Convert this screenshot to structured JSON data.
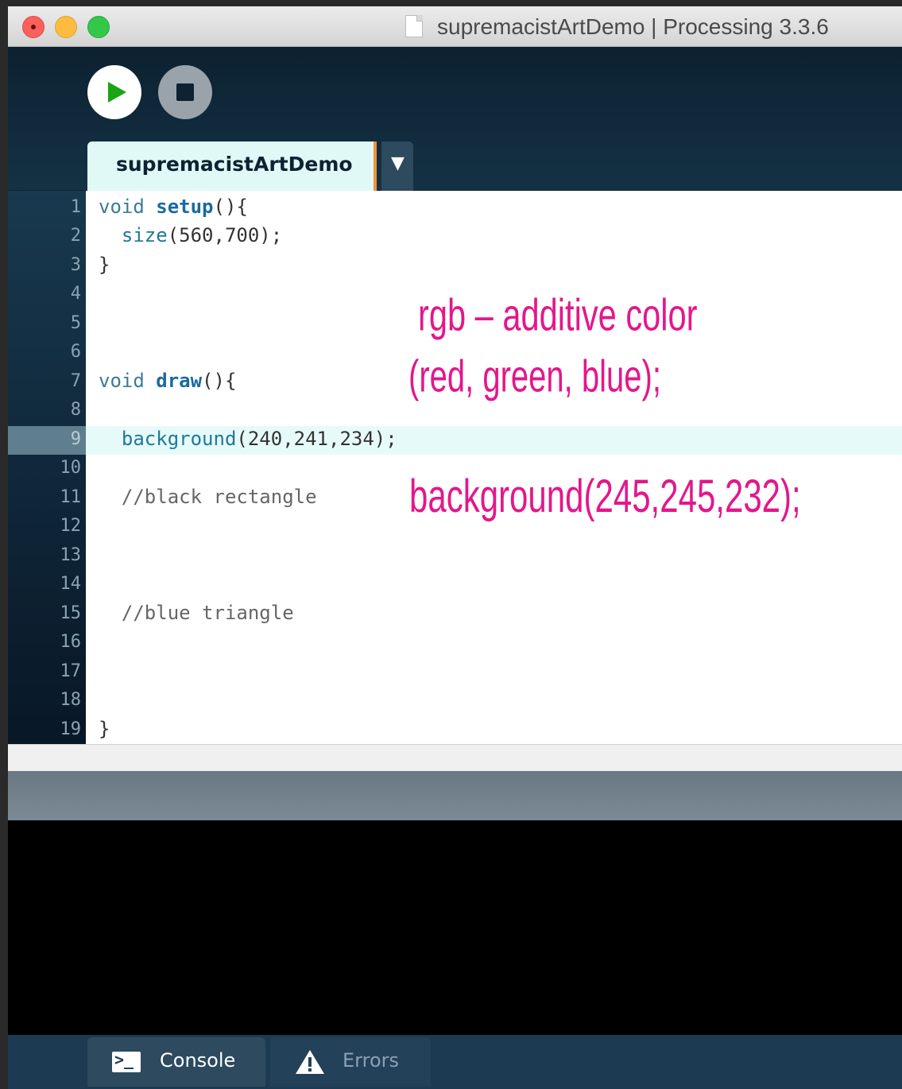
{
  "window": {
    "title": "supremacistArtDemo | Processing 3.3.6"
  },
  "toolbar": {
    "run_icon": "play-icon",
    "stop_icon": "stop-icon"
  },
  "editor": {
    "tab_label": "supremacistArtDemo",
    "tab_menu_glyph": "▼",
    "current_line": 9,
    "line_numbers": [
      "1",
      "2",
      "3",
      "4",
      "5",
      "6",
      "7",
      "8",
      "9",
      "10",
      "11",
      "12",
      "13",
      "14",
      "15",
      "16",
      "17",
      "18",
      "19"
    ],
    "code": {
      "l1_void": "void ",
      "l1_fn": "setup",
      "l1_rest": "(){",
      "l2_indent": "  ",
      "l2_fn": "size",
      "l2_rest": "(560,700);",
      "l3": "}",
      "l7_void": "void ",
      "l7_fn": "draw",
      "l7_rest": "(){",
      "l9_indent": "  ",
      "l9_fn": "background",
      "l9_rest": "(240,241,234);",
      "l11": "  //black rectangle",
      "l15": "  //blue triangle",
      "l19": "}"
    }
  },
  "annotations": {
    "rgb_line1": "rgb – additive color",
    "rgb_line2": "(red, green, blue);",
    "background_example": "background(245,245,232);",
    "color": "#e3178c"
  },
  "bottom_tabs": {
    "console_label": "Console",
    "console_icon": "console-icon",
    "errors_label": "Errors",
    "errors_icon": "warning-icon"
  },
  "colors": {
    "editor_bg": "#ffffff",
    "current_line_bg": "#e6fbf9",
    "window_bg": "#0d2233",
    "console_bg": "#000000"
  }
}
